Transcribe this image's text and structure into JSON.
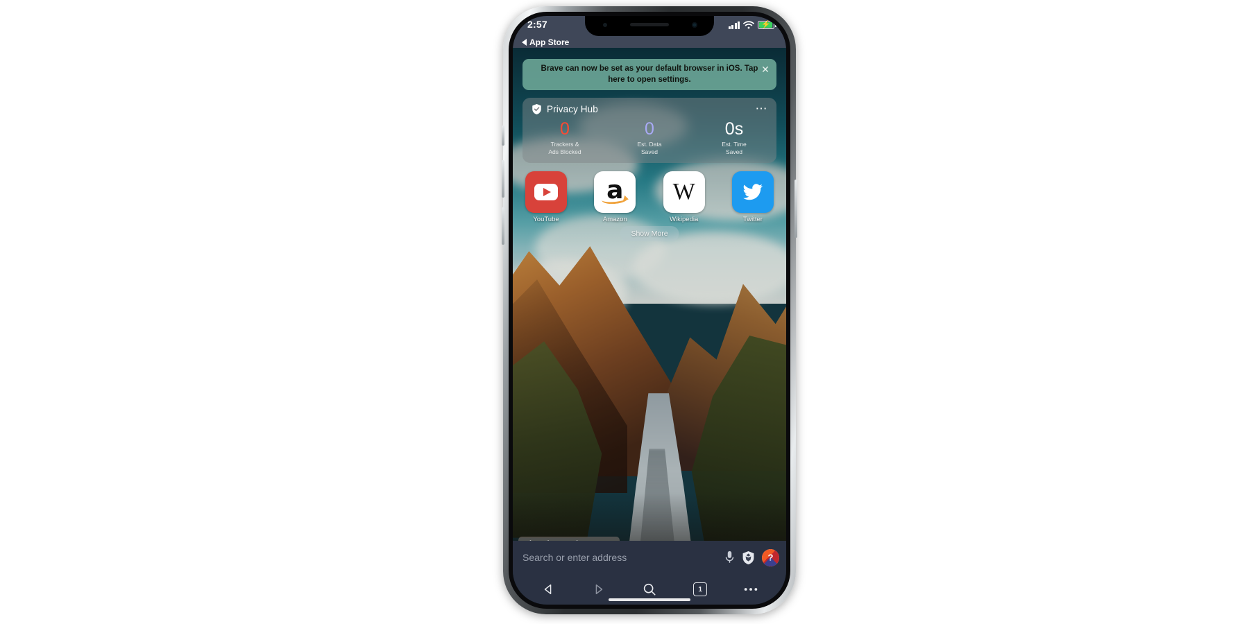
{
  "status_bar": {
    "time": "2:57",
    "back_app_label": "App Store",
    "signal_icon": "cellular-signal-icon",
    "wifi_icon": "wifi-icon",
    "battery_icon": "battery-charging-icon"
  },
  "notification": {
    "message": "Brave can now be set as your default browser in iOS. Tap here to open settings.",
    "close_icon": "close-icon",
    "background_color": "#6ea898"
  },
  "privacy_hub": {
    "title": "Privacy Hub",
    "shield_icon": "shield-check-icon",
    "more_icon": "ellipsis-icon",
    "stats": [
      {
        "value": "0",
        "label": "Trackers &\nAds Blocked",
        "label_line1": "Trackers &",
        "label_line2": "Ads Blocked",
        "color": "#fc4a33"
      },
      {
        "value": "0",
        "label": "Est. Data\nSaved",
        "label_line1": "Est. Data",
        "label_line2": "Saved",
        "color": "#a9aaf6"
      },
      {
        "value": "0s",
        "label": "Est. Time\nSaved",
        "label_line1": "Est. Time",
        "label_line2": "Saved",
        "color": "#ffffff"
      }
    ]
  },
  "shortcuts": [
    {
      "label": "YouTube",
      "icon": "youtube-icon",
      "tile_color": "#d8423a"
    },
    {
      "label": "Amazon",
      "icon": "amazon-icon",
      "tile_color": "#ffffff"
    },
    {
      "label": "Wikipedia",
      "icon": "wikipedia-icon",
      "tile_color": "#ffffff"
    },
    {
      "label": "Twitter",
      "icon": "twitter-icon",
      "tile_color": "#1d9bf0"
    }
  ],
  "show_more": {
    "label": "Show More"
  },
  "photo_credit": {
    "text": "Photo by Corwin Prescott"
  },
  "bottom_sheet": {
    "close_icon": "close-icon",
    "handle_icon": "drag-handle-dot"
  },
  "address_bar": {
    "placeholder": "Search or enter address",
    "value": "",
    "mic_icon": "microphone-icon",
    "shields_icon": "brave-shields-icon",
    "profile_icon": "brave-profile-icon",
    "profile_badge_text": "?"
  },
  "toolbar": {
    "back_label": "Back",
    "forward_label": "Forward",
    "search_label": "Search",
    "tabs_count": "1",
    "menu_label": "More",
    "back_icon": "chevron-back-icon",
    "forward_icon": "chevron-forward-icon",
    "search_icon": "search-icon",
    "tabs_icon": "tab-count-icon",
    "menu_icon": "ellipsis-icon"
  }
}
